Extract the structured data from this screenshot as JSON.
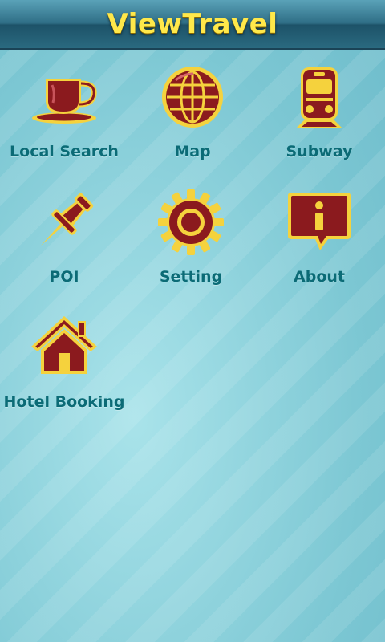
{
  "app": {
    "title": "ViewTravel"
  },
  "colors": {
    "icon_fill": "#8b1a1e",
    "icon_outline": "#f5d23d",
    "label": "#0b6b76",
    "header": "#1d5268",
    "title": "#ffe84a"
  },
  "menu": [
    {
      "label": "Local Search",
      "icon": "coffee-cup-icon"
    },
    {
      "label": "Map",
      "icon": "globe-icon"
    },
    {
      "label": "Subway",
      "icon": "train-icon"
    },
    {
      "label": "POI",
      "icon": "pushpin-icon"
    },
    {
      "label": "Setting",
      "icon": "gear-icon"
    },
    {
      "label": "About",
      "icon": "info-icon"
    },
    {
      "label": "Hotel Booking",
      "icon": "house-icon"
    }
  ]
}
